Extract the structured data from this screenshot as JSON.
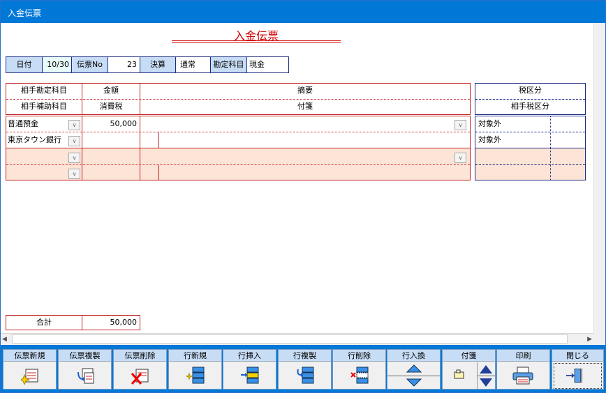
{
  "window": {
    "title": "入金伝票"
  },
  "document": {
    "title": "入金伝票"
  },
  "header": {
    "date_label": "日付",
    "date_value": "10/30",
    "slip_no_label": "伝票No",
    "slip_no_value": "23",
    "settlement_label": "決算",
    "settlement_value": "通常",
    "account_label": "勘定科目",
    "account_value": "現金"
  },
  "columns": {
    "counter_account": "相手勘定科目",
    "counter_sub_account": "相手補助科目",
    "amount": "金額",
    "consumption_tax": "消費税",
    "summary": "摘要",
    "sticky_note": "付箋",
    "tax_category": "税区分",
    "counter_tax_category": "相手税区分"
  },
  "rows": [
    {
      "counter_account": "普通預金",
      "counter_sub_account": "東京タウン銀行",
      "amount": "50,000",
      "tax": "",
      "tax_category": "対象外",
      "counter_tax_category": "対象外"
    },
    {
      "counter_account": "",
      "counter_sub_account": "",
      "amount": "",
      "tax": "",
      "tax_category": "",
      "counter_tax_category": ""
    }
  ],
  "total": {
    "label": "合計",
    "value": "50,000"
  },
  "toolbar": {
    "new_slip": "伝票新規",
    "copy_slip": "伝票複製",
    "delete_slip": "伝票削除",
    "new_row": "行新規",
    "insert_row": "行挿入",
    "copy_row": "行複製",
    "delete_row": "行削除",
    "swap_row": "行入換",
    "sticky": "付箋",
    "print": "印刷",
    "close": "閉じる"
  },
  "colors": {
    "titlebar": "#0078d7",
    "accent_red": "#c02020",
    "header_fill": "#c7dcf5",
    "row_highlight": "#fce4d6",
    "navy": "#1b2a80"
  }
}
